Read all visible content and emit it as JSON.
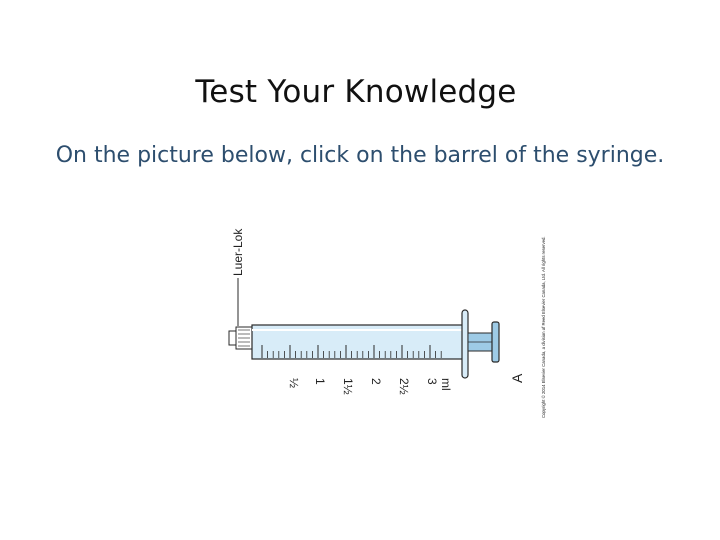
{
  "header": {
    "title": "Test Your Knowledge"
  },
  "question": {
    "prompt": "On the picture below, click on the barrel of the syringe."
  },
  "figure": {
    "tip_label": "Luer-Lok",
    "scale_labels": [
      "½",
      "1",
      "1½",
      "2",
      "2½",
      "3",
      "ml"
    ],
    "figure_letter": "A",
    "copyright": "Copyright © 2014 Elsevier Canada, a division of Reed Elsevier Canada, Ltd. All rights reserved.",
    "colors": {
      "barrel_fill": "#d8ecf8",
      "plunger_fill": "#9ecbe6",
      "outline": "#2a2a2a"
    }
  }
}
